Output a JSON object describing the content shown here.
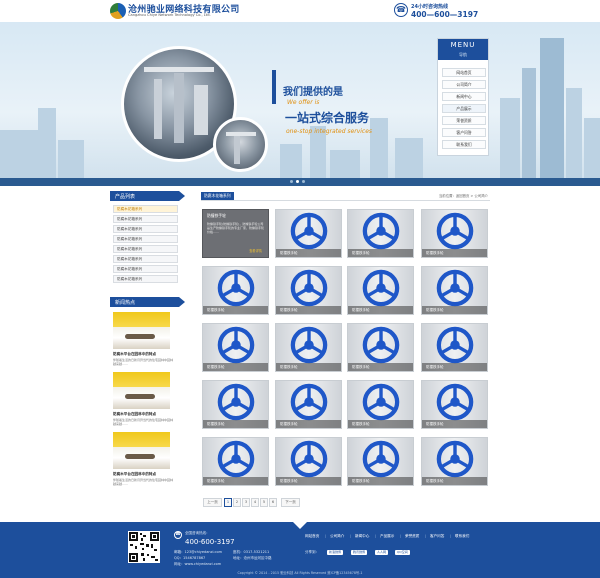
{
  "header": {
    "logo_cn": "沧州驰业网络科技有限公司",
    "logo_en": "Cangzhou Chiye Network Technology Co., Ltd.",
    "hotline_label": "24小时咨询热线",
    "hotline_number": "400—600—3197"
  },
  "banner": {
    "slogan_cn_1": "我们提供的是",
    "slogan_en_1": "We offer is",
    "slogan_cn_2": "一站式综合服务",
    "slogan_en_2": "one-stop integrated services",
    "menu_title": "MENU",
    "menu_subtitle": "导航",
    "menu_items": [
      "网站首页",
      "公司简介",
      "新闻中心",
      "产品展示",
      "荣誉资质",
      "客户问答",
      "联系我们"
    ]
  },
  "sidebar": {
    "products_title": "产品列表",
    "categories": [
      "防腐木花箱系列",
      "防腐木花箱系列",
      "防腐木花箱系列",
      "防腐木花箱系列",
      "防腐木花箱系列",
      "防腐木花箱系列",
      "防腐木花箱系列",
      "防腐木花箱系列"
    ],
    "news_title": "新闻热点",
    "news": [
      {
        "title": "防腐木平台在园林中的特点",
        "desc": "伴随着生活的日新月异当代的住宅园林中园林越来越……"
      },
      {
        "title": "防腐木平台在园林中的特点",
        "desc": "伴随着生活的日新月异当代的住宅园林中园林越来越……"
      },
      {
        "title": "防腐木平台在园林中的特点",
        "desc": "伴随着生活的日新月异当代的住宅园林中园林越来越……"
      }
    ]
  },
  "main": {
    "section_title": "防腐木花箱系列",
    "breadcrumb": "当前位置：返回首页 > 公司简介",
    "first_product": {
      "title": "防撞铁手轮",
      "desc": "防撞铁手轮(防撞铁手轮)，防撞铁手轮公司是生产防撞铁手轮的专业厂家，防撞铁手轮价格……",
      "more": "查看详情"
    },
    "product_caption": "防撞铁手轮"
  },
  "pagination": {
    "prev": "上一页",
    "pages": [
      "1",
      "2",
      "3",
      "4",
      "5",
      "6"
    ],
    "next": "下一页"
  },
  "footer": {
    "hotline_label": "全国咨询热线：",
    "hotline_number": "400-600-3197",
    "contact_left": [
      "邮箱：123@chiyedanzi.com",
      "QQ：1546787867",
      "网址：www.chiyedanzi.com"
    ],
    "contact_right": [
      "座机：0317-5321211",
      "地址：沧州市运河区中路"
    ],
    "links": [
      "网站首页",
      "公司简介",
      "新闻中心",
      "产品展示",
      "荣誉资质",
      "客户问答",
      "联系我们"
    ],
    "share_label": "分享到：",
    "share_buttons": [
      "新浪微博",
      "腾讯微博",
      "人人网",
      "QQ空间"
    ],
    "copyright": "Copyright © 2014 - 2015 驰业科技 All Rights Reserved    冀ICP备12345678号-1"
  },
  "colors": {
    "brand": "#1d4f9c",
    "accent": "#e09010",
    "footer": "#1d4f9c"
  }
}
